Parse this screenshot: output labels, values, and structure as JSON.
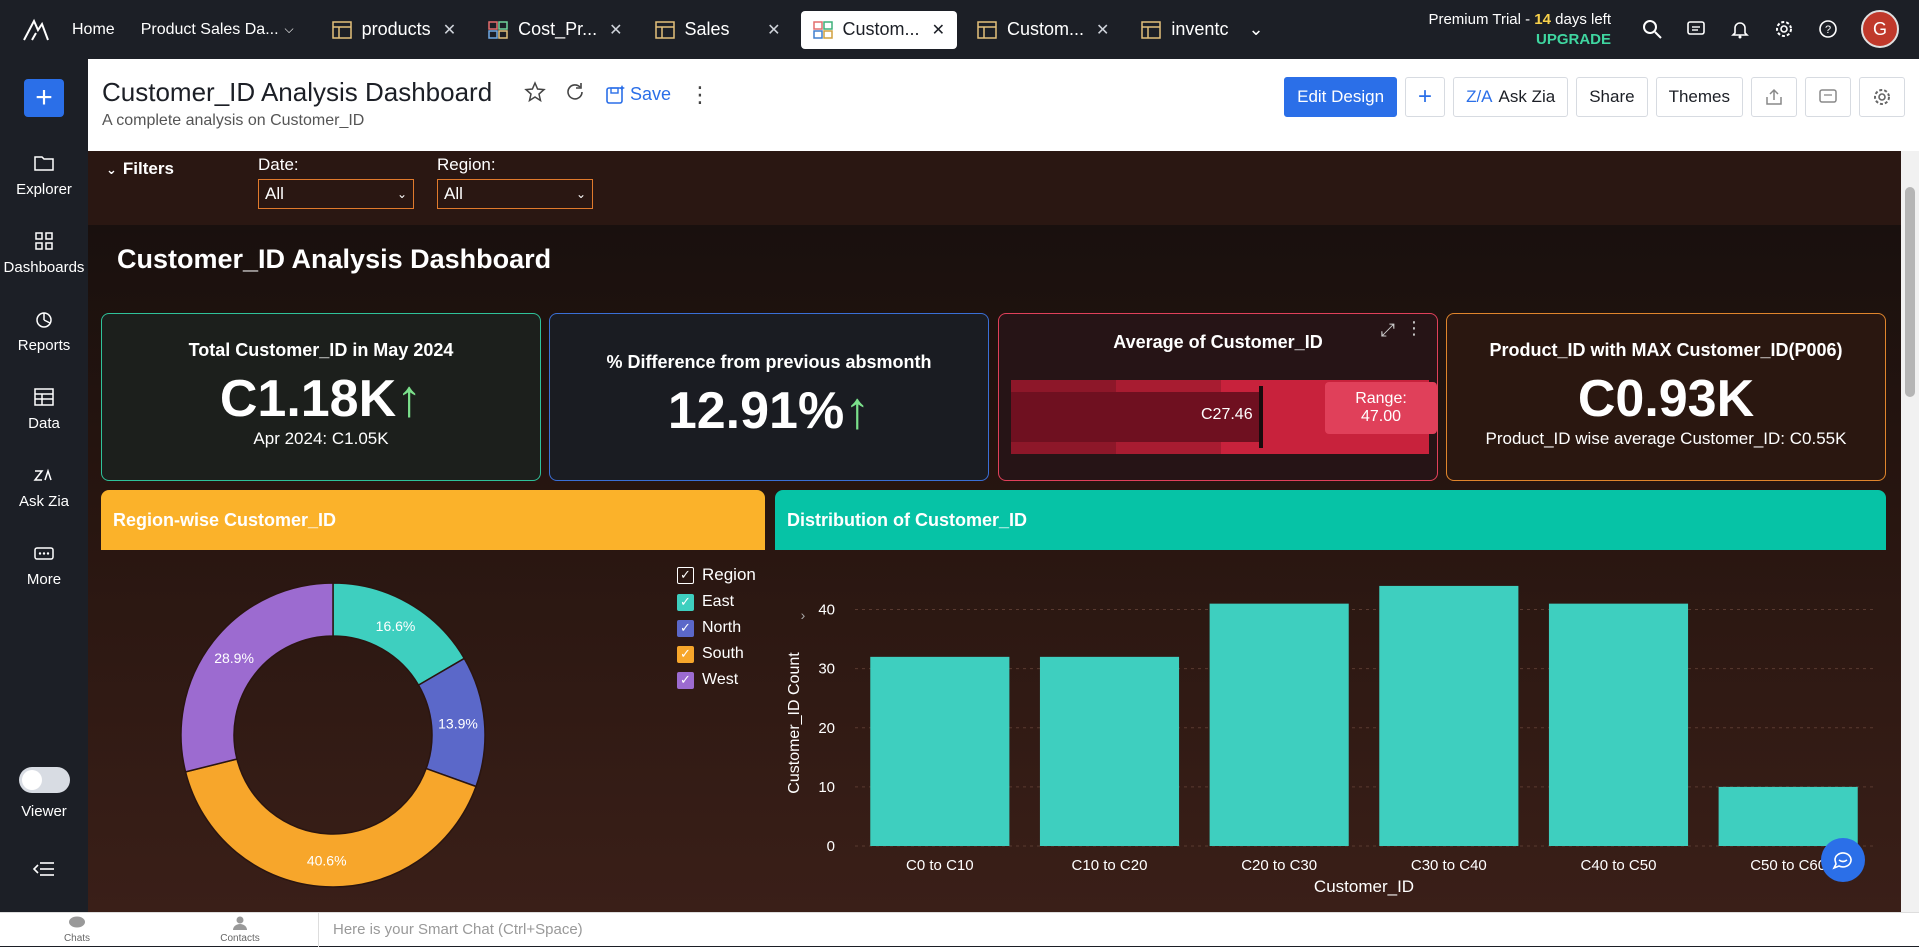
{
  "topbar": {
    "links": [
      {
        "label": "Home"
      },
      {
        "label": "Product Sales Da..."
      }
    ],
    "tabs": [
      {
        "label": "products",
        "icon": "table-icon",
        "active": false
      },
      {
        "label": "Cost_Pr...",
        "icon": "dashboard-icon",
        "active": false
      },
      {
        "label": "Sales",
        "icon": "table-icon",
        "active": false
      },
      {
        "label": "Custom...",
        "icon": "dashboard-icon",
        "active": true
      },
      {
        "label": "Custom...",
        "icon": "table-icon",
        "active": false
      },
      {
        "label": "inventc",
        "icon": "table-icon",
        "active": false
      }
    ],
    "trial_prefix": "Premium Trial - ",
    "trial_days": "14",
    "trial_suffix": " days left",
    "upgrade": "UPGRADE",
    "avatar_initial": "G"
  },
  "sidebar": {
    "items": [
      {
        "label": "Explorer"
      },
      {
        "label": "Dashboards"
      },
      {
        "label": "Reports"
      },
      {
        "label": "Data"
      },
      {
        "label": "Ask Zia"
      },
      {
        "label": "More"
      }
    ],
    "viewer_label": "Viewer"
  },
  "header": {
    "title": "Customer_ID Analysis Dashboard",
    "subtitle": "A complete analysis on Customer_ID",
    "save_label": "Save",
    "edit_design": "Edit Design",
    "ask_zia": "Ask Zia",
    "share": "Share",
    "themes": "Themes"
  },
  "filters": {
    "title": "Filters",
    "date_label": "Date:",
    "date_value": "All",
    "region_label": "Region:",
    "region_value": "All"
  },
  "canvas_title": "Customer_ID Analysis Dashboard",
  "kpis": {
    "total": {
      "title": "Total Customer_ID in May 2024",
      "value": "C1.18K",
      "sub": "Apr 2024: C1.05K"
    },
    "diff": {
      "title": "% Difference from previous absmonth",
      "value": "12.91%"
    },
    "avg": {
      "title": "Average of Customer_ID",
      "value": "C27.46",
      "range_label": "Range: 47.00"
    },
    "max": {
      "title": "Product_ID with MAX Customer_ID(P006)",
      "value": "C0.93K",
      "sub": "Product_ID wise average Customer_ID: C0.55K"
    }
  },
  "colors": {
    "east": "#3ecfbf",
    "north": "#5b68c9",
    "south": "#f7a62b",
    "west": "#9c6bd0",
    "bar": "#3ecfbf",
    "region_header": "#fbb22a",
    "dist_header": "#06c3a6"
  },
  "region_chart": {
    "title": "Region-wise Customer_ID",
    "legend_title": "Region",
    "chart_data": {
      "type": "pie",
      "categories": [
        "East",
        "North",
        "South",
        "West"
      ],
      "values": [
        16.6,
        13.9,
        40.6,
        28.9
      ],
      "labels": [
        "16.6%",
        "13.9%",
        "40.6%",
        "28.9%"
      ]
    }
  },
  "dist_chart": {
    "title": "Distribution of Customer_ID",
    "chart_data": {
      "type": "bar",
      "categories": [
        "C0 to C10",
        "C10 to C20",
        "C20 to C30",
        "C30 to C40",
        "C40 to C50",
        "C50 to C60"
      ],
      "values": [
        32,
        32,
        41,
        44,
        41,
        10
      ],
      "xlabel": "Customer_ID",
      "ylabel": "Customer_ID Count",
      "ylim": [
        0,
        45
      ],
      "yticks": [
        "0",
        "10",
        "20",
        "30",
        "40"
      ]
    }
  },
  "bottombar": {
    "chats": "Chats",
    "contacts": "Contacts",
    "chat_placeholder": "Here is your Smart Chat (Ctrl+Space)"
  }
}
